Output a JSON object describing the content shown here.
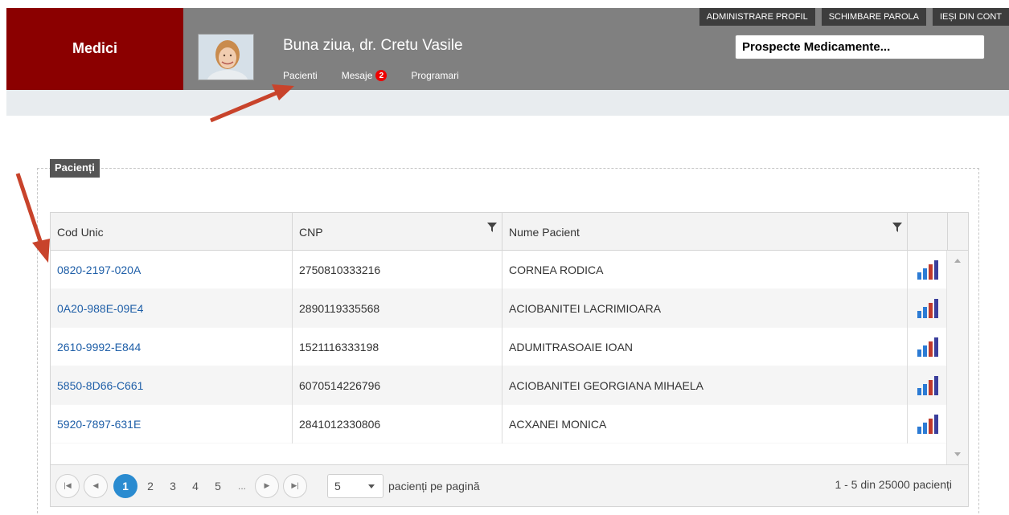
{
  "app": {
    "brand": "Medici"
  },
  "header": {
    "greeting": "Buna ziua, dr. Cretu Vasile",
    "nav": [
      {
        "label": "Pacienti"
      },
      {
        "label": "Mesaje",
        "badge": "2"
      },
      {
        "label": "Programari"
      }
    ],
    "top_links": [
      "ADMINISTRARE PROFIL",
      "SCHIMBARE PAROLA",
      "IEȘI DIN CONT"
    ],
    "search_text": "Prospecte Medicamente..."
  },
  "panel": {
    "legend": "Pacienți"
  },
  "grid": {
    "columns": [
      "Cod Unic",
      "CNP",
      "Nume Pacient"
    ],
    "rows": [
      {
        "code": "0820-2197-020A",
        "cnp": "2750810333216",
        "name": "CORNEA RODICA"
      },
      {
        "code": "0A20-988E-09E4",
        "cnp": "2890119335568",
        "name": "ACIOBANITEI LACRIMIOARA"
      },
      {
        "code": "2610-9992-E844",
        "cnp": "1521116333198",
        "name": "ADUMITRASOAIE IOAN"
      },
      {
        "code": "5850-8D66-C661",
        "cnp": "6070514226796",
        "name": "ACIOBANITEI GEORGIANA MIHAELA"
      },
      {
        "code": "5920-7897-631E",
        "cnp": "2841012330806",
        "name": "ACXANEI MONICA"
      }
    ]
  },
  "pager": {
    "pages": [
      "1",
      "2",
      "3",
      "4",
      "5"
    ],
    "ellipsis": "...",
    "page_size": "5",
    "page_size_label": "pacienți pe pagină",
    "summary": "1 - 5 din 25000 pacienți"
  },
  "colors": {
    "brand": "#8b0000",
    "header": "#808080",
    "link": "#1f5fa8",
    "active_page": "#2a8bd0",
    "arrow": "#c8432b"
  }
}
